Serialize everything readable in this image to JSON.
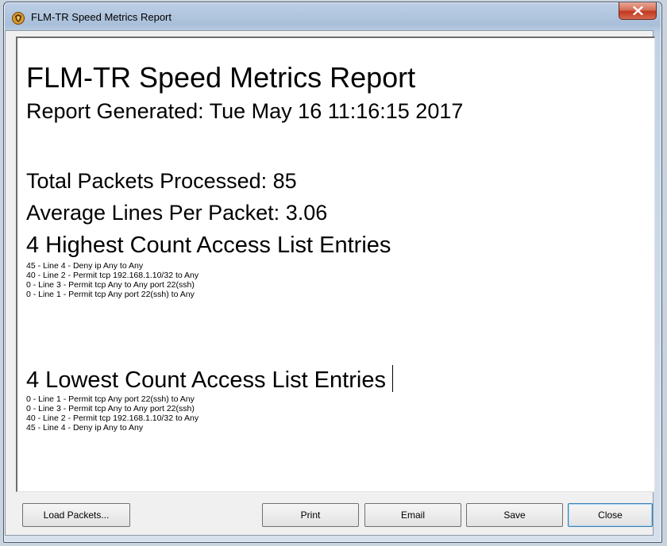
{
  "window": {
    "title": "FLM-TR Speed Metrics Report",
    "app_icon": "shield-app-icon",
    "close_icon": "close-icon"
  },
  "report": {
    "title": "FLM-TR Speed Metrics Report",
    "generated": "Report Generated: Tue May 16 11:16:15 2017",
    "total_packets": "Total Packets Processed: 85",
    "average_lines": "Average Lines Per Packet: 3.06",
    "highest": {
      "heading": "4 Highest Count Access List Entries",
      "entries": [
        "45 - Line 4 - Deny ip Any to Any",
        "40 - Line 2 - Permit tcp 192.168.1.10/32 to Any",
        "0 - Line 3 - Permit tcp Any to Any port 22(ssh)",
        "0 - Line 1 - Permit tcp Any port 22(ssh) to Any"
      ]
    },
    "lowest": {
      "heading": "4 Lowest Count Access List Entries",
      "entries": [
        "0 - Line 1 - Permit tcp Any port 22(ssh) to Any",
        "0 - Line 3 - Permit tcp Any to Any port 22(ssh)",
        "40 - Line 2 - Permit tcp 192.168.1.10/32 to Any",
        "45 - Line 4 - Deny ip Any to Any"
      ]
    }
  },
  "buttons": {
    "load": "Load Packets...",
    "print": "Print",
    "email": "Email",
    "save": "Save",
    "close": "Close"
  }
}
